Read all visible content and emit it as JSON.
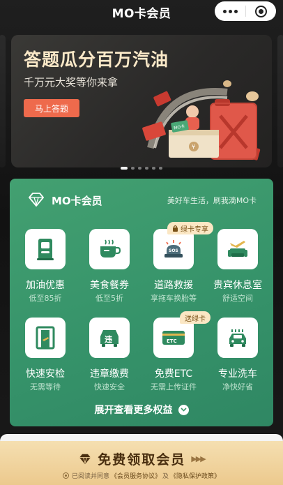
{
  "nav": {
    "title": "MO卡会员"
  },
  "banner": {
    "title": "答题瓜分百万汽油",
    "subtitle": "千万元大奖等你来拿",
    "button": "马上答题",
    "can_label": "MO卡",
    "coin_label": "¥"
  },
  "card": {
    "title": "MO卡会员",
    "slogan": "美好车生活，刷我滴MO卡",
    "benefits": [
      {
        "label": "加油优惠",
        "sub": "低至85折",
        "icon": "fuel-pump-icon"
      },
      {
        "label": "美食餐券",
        "sub": "低至5折",
        "icon": "coffee-cup-icon"
      },
      {
        "label": "道路救援",
        "sub": "享拖车换胎等",
        "icon": "sos-siren-icon",
        "badge": "绿卡专享"
      },
      {
        "label": "贵宾休息室",
        "sub": "舒适空间",
        "icon": "lounge-sofa-icon"
      },
      {
        "label": "快速安检",
        "sub": "无需等待",
        "icon": "security-gate-icon"
      },
      {
        "label": "违章缴费",
        "sub": "快速安全",
        "icon": "violation-car-icon",
        "glyph": "违"
      },
      {
        "label": "免费ETC",
        "sub": "无需上传证件",
        "icon": "etc-card-icon",
        "badge": "送绿卡",
        "glyph": "ETC"
      },
      {
        "label": "专业洗车",
        "sub": "净快好省",
        "icon": "car-wash-icon"
      }
    ],
    "expand": "展开查看更多权益"
  },
  "cta": {
    "label": "免费领取会员",
    "agreement_prefix": "已阅读并同意",
    "agreement_link1": "《会员服务协议》",
    "agreement_and": "及",
    "agreement_link2": "《隐私保护政策》"
  },
  "colors": {
    "card_green": "#3c9a6d",
    "accent_orange": "#ee6a4c",
    "cta_gold": "#efd09a",
    "badge_cream": "#fbe7c4"
  }
}
